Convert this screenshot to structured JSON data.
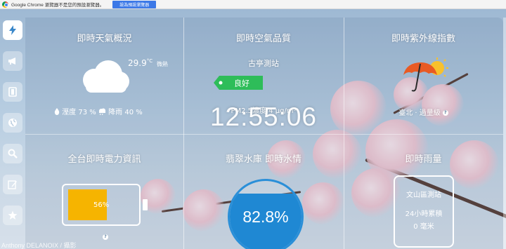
{
  "infobar": {
    "message": "Google Chrome 瀏覽器不是您的預設瀏覽器。",
    "set_default_label": "設為預設瀏覽器"
  },
  "sidebar": {
    "items": [
      {
        "icon": "lightning-icon",
        "active": true
      },
      {
        "icon": "megaphone-icon",
        "active": false
      },
      {
        "icon": "film-icon",
        "active": false
      },
      {
        "icon": "globe-icon",
        "active": false
      },
      {
        "icon": "search-icon",
        "active": false
      },
      {
        "icon": "edit-icon",
        "active": false
      },
      {
        "icon": "star-icon",
        "active": false
      }
    ]
  },
  "weather": {
    "title": "即時天氣概況",
    "temperature": "29.9",
    "unit": "°C",
    "description": "微熱",
    "humidity_text": "溼度 73 %",
    "rain_chance_text": "降雨 40 %"
  },
  "air": {
    "title": "即時空氣品質",
    "station": "古亭測站",
    "status": "良好",
    "status_color": "#2ebd59",
    "pm_text": "PM2.5濃度 4 μg/m³"
  },
  "clock": {
    "time": "12:55:06"
  },
  "uv": {
    "title": "即時紫外線指數",
    "city_text": "臺北 · 過量級"
  },
  "power": {
    "title": "全台即時電力資訊",
    "percent_text": "56%",
    "percent": 0.56,
    "fill_color": "#f6b400"
  },
  "reservoir": {
    "title": "翡翠水庫 即時水情",
    "percent_text": "82.8%",
    "level": 0.828,
    "water_color": "#1f88d3"
  },
  "rain": {
    "title": "即時雨量",
    "station": "文山區測站",
    "label": "24小時累積",
    "value": "0 毫米"
  },
  "credit": "Anthony DELANOIX / 攝影"
}
